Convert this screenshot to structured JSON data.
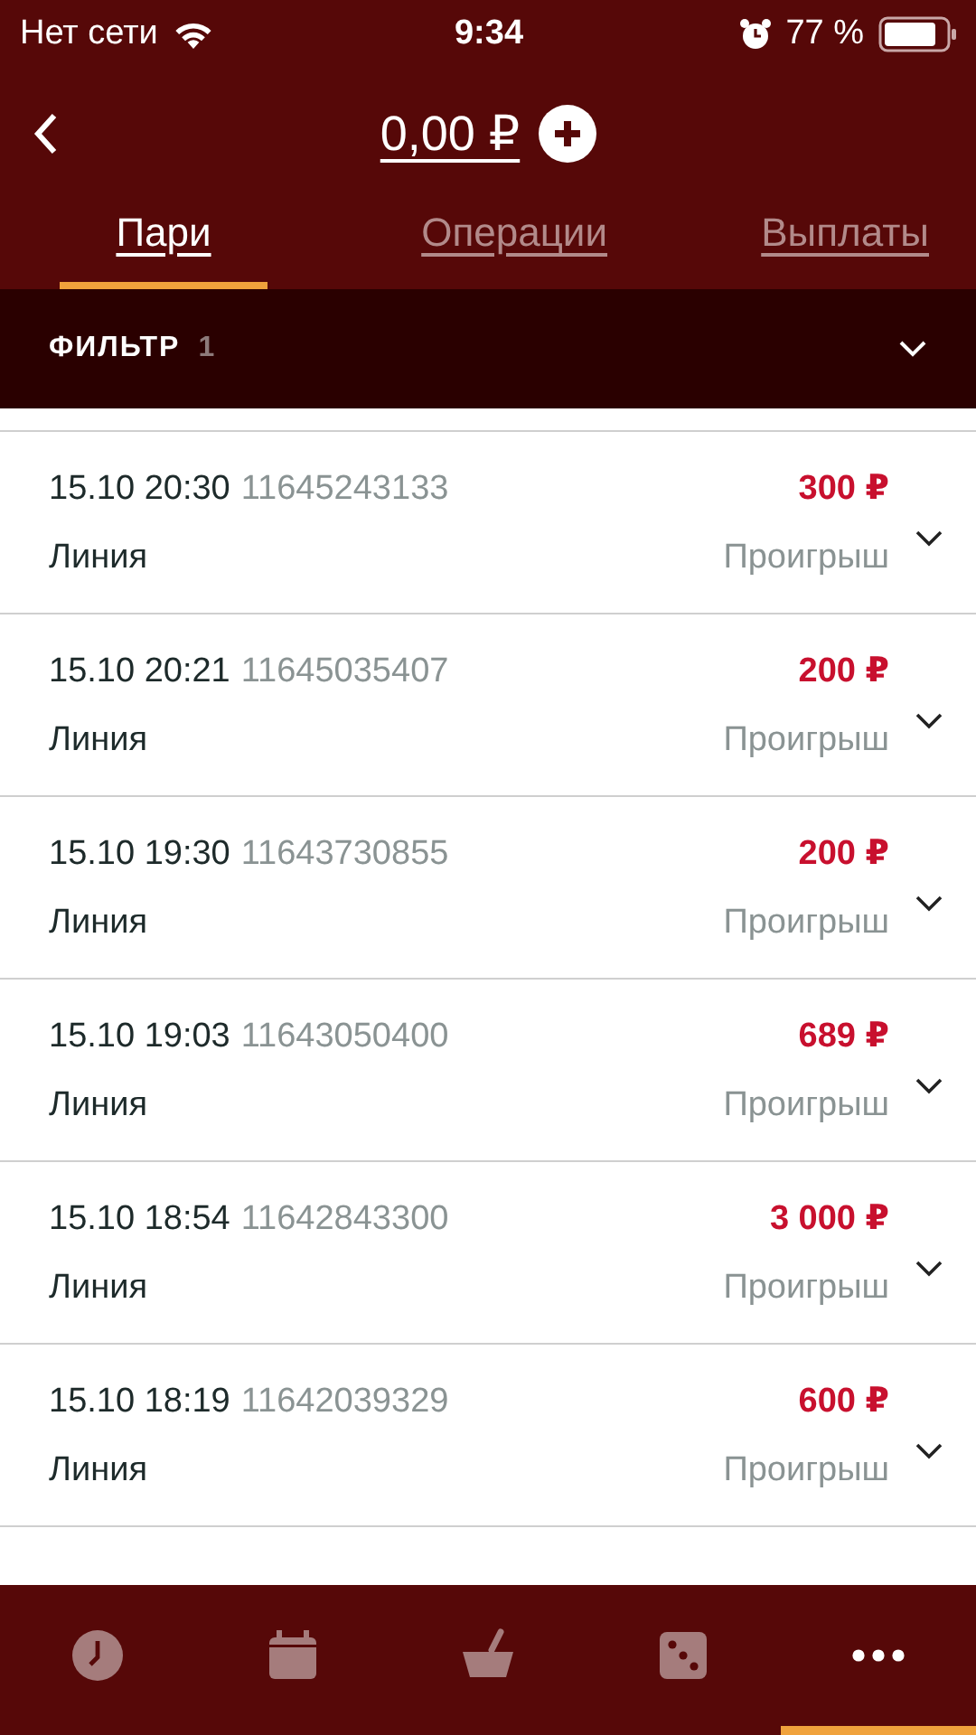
{
  "status_bar": {
    "carrier": "Нет сети",
    "time": "9:34",
    "battery": "77 %"
  },
  "header": {
    "balance": "0,00 ₽"
  },
  "tabs": [
    {
      "label": "Пари",
      "selected": true
    },
    {
      "label": "Операции",
      "selected": false
    },
    {
      "label": "Выплаты",
      "selected": false
    }
  ],
  "filter": {
    "label": "ФИЛЬТР",
    "count": "1"
  },
  "bets": [
    {
      "datetime": "15.10 20:30",
      "number": "11645243133",
      "amount": "300 ₽",
      "type": "Линия",
      "result": "Проигрыш"
    },
    {
      "datetime": "15.10 20:21",
      "number": "11645035407",
      "amount": "200 ₽",
      "type": "Линия",
      "result": "Проигрыш"
    },
    {
      "datetime": "15.10 19:30",
      "number": "11643730855",
      "amount": "200 ₽",
      "type": "Линия",
      "result": "Проигрыш"
    },
    {
      "datetime": "15.10 19:03",
      "number": "11643050400",
      "amount": "689 ₽",
      "type": "Линия",
      "result": "Проигрыш"
    },
    {
      "datetime": "15.10 18:54",
      "number": "11642843300",
      "amount": "3 000 ₽",
      "type": "Линия",
      "result": "Проигрыш"
    },
    {
      "datetime": "15.10 18:19",
      "number": "11642039329",
      "amount": "600 ₽",
      "type": "Линия",
      "result": "Проигрыш"
    }
  ],
  "bottom_nav": [
    {
      "kind": "clock",
      "selected": false
    },
    {
      "kind": "calendar",
      "selected": false
    },
    {
      "kind": "bowl",
      "selected": false
    },
    {
      "kind": "dice",
      "selected": false
    },
    {
      "kind": "more",
      "selected": true
    }
  ]
}
